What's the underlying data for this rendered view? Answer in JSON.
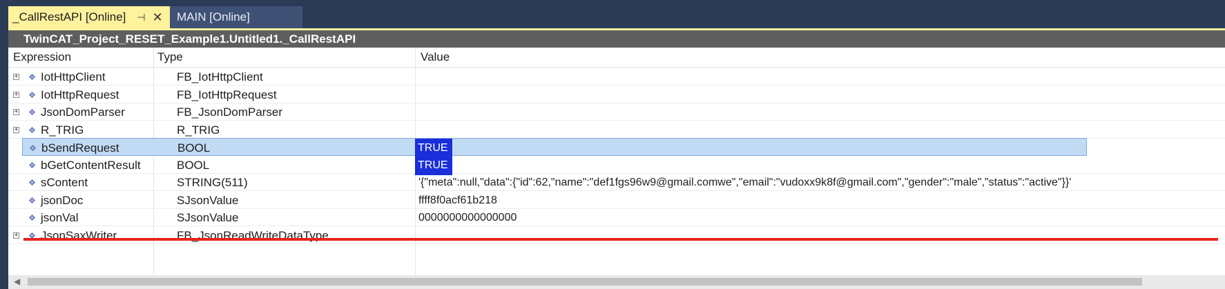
{
  "tabs": [
    {
      "label": "_CallRestAPI [Online]",
      "active": true,
      "pin": "⊣",
      "close": "✕"
    },
    {
      "label": "MAIN [Online]",
      "active": false
    }
  ],
  "path": "TwinCAT_Project_RESET_Example1.Untitled1._CallRestAPI",
  "columns": {
    "expression": "Expression",
    "type": "Type",
    "value": "Value"
  },
  "rows": [
    {
      "name": "IotHttpClient",
      "type": "FB_IotHttpClient",
      "value": "",
      "expandable": true
    },
    {
      "name": "IotHttpRequest",
      "type": "FB_IotHttpRequest",
      "value": "",
      "expandable": true
    },
    {
      "name": "JsonDomParser",
      "type": "FB_JsonDomParser",
      "value": "",
      "expandable": true
    },
    {
      "name": "R_TRIG",
      "type": "R_TRIG",
      "value": "",
      "expandable": true
    },
    {
      "name": "bSendRequest",
      "type": "BOOL",
      "value": "TRUE",
      "expandable": false,
      "selected": true
    },
    {
      "name": "bGetContentResult",
      "type": "BOOL",
      "value": "TRUE",
      "expandable": false
    },
    {
      "name": "sContent",
      "type": "STRING(511)",
      "value": "'{\"meta\":null,\"data\":{\"id\":62,\"name\":\"def1fgs96w9@gmail.comwe\",\"email\":\"vudoxx9k8f@gmail.com\",\"gender\":\"male\",\"status\":\"active\"}}'",
      "expandable": false
    },
    {
      "name": "jsonDoc",
      "type": "SJsonValue",
      "value": "ffff8f0acf61b218",
      "expandable": false
    },
    {
      "name": "jsonVal",
      "type": "SJsonValue",
      "value": "0000000000000000",
      "expandable": false
    },
    {
      "name": "JsonSaxWriter",
      "type": "FB_JsonReadWriteDataType",
      "value": "",
      "expandable": true
    }
  ],
  "colors": {
    "accent_tab": "#fff29d",
    "bool_value_bg": "#1a2fd9",
    "selection_bg": "#c1dbf4",
    "highlight_line": "#e8251e",
    "path_bar": "#5e5e5e"
  },
  "icons": {
    "expander": "plus-box-icon",
    "variable": "variable-diamond-icon"
  }
}
